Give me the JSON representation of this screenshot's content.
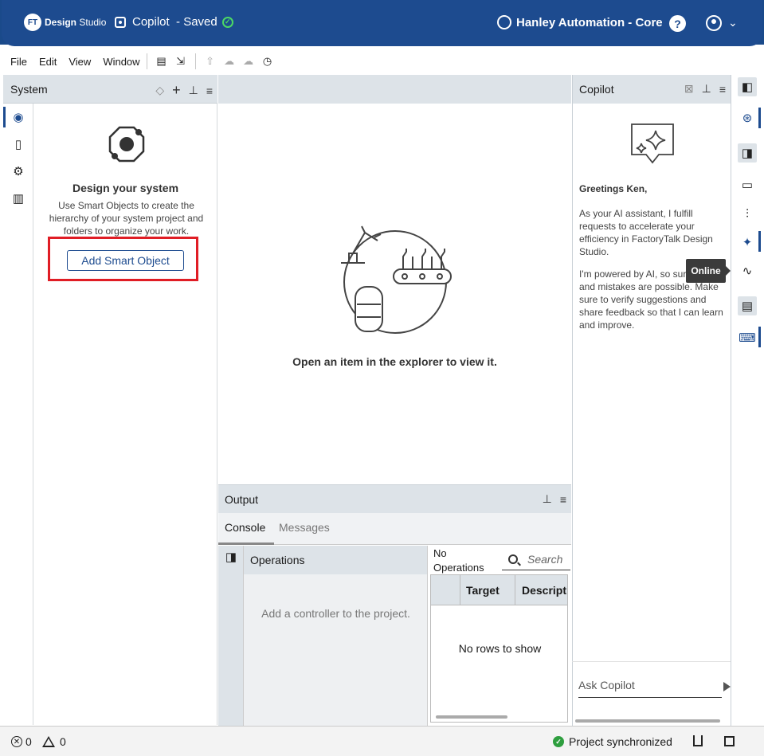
{
  "header": {
    "logo_badge": "FT",
    "logo_bold": "Design",
    "logo_light": "Studio",
    "project_name": "Copilot",
    "project_status": "- Saved",
    "org_name": "Hanley Automation - Core",
    "help_label": "?",
    "user_chevron": "⌄"
  },
  "menu": {
    "items": [
      "File",
      "Edit",
      "View",
      "Window"
    ]
  },
  "system_panel": {
    "title": "System",
    "empty_title": "Design your system",
    "empty_desc": "Use Smart Objects to create the hierarchy of your system project and folders to organize your work.",
    "add_button": "Add Smart Object"
  },
  "center": {
    "empty_message": "Open an item in the explorer to view it."
  },
  "output_panel": {
    "title": "Output",
    "tabs": [
      "Console",
      "Messages"
    ],
    "operations_title": "Operations",
    "operations_empty": "Add a controller to the project.",
    "no_operations": "No Operations",
    "search_placeholder": "Search",
    "grid_columns": [
      "Target",
      "Descripti"
    ],
    "grid_empty": "No rows to show"
  },
  "copilot_panel": {
    "title": "Copilot",
    "greeting": "Greetings Ken,",
    "para1": "As your AI assistant, I fulfill requests to accelerate your efficiency in FactoryTalk Design Studio.",
    "para2": "I'm powered by AI, so surprises and mistakes are possible. Make sure to verify suggestions and share feedback so that I can learn and improve.",
    "ask_placeholder": "Ask Copilot"
  },
  "tooltip": {
    "text": "Online"
  },
  "status_bar": {
    "errors": "0",
    "warnings": "0",
    "sync_text": "Project synchronized"
  },
  "colors": {
    "brand": "#1d4b8f",
    "highlight": "#e01d25",
    "success": "#2e9e3e"
  }
}
